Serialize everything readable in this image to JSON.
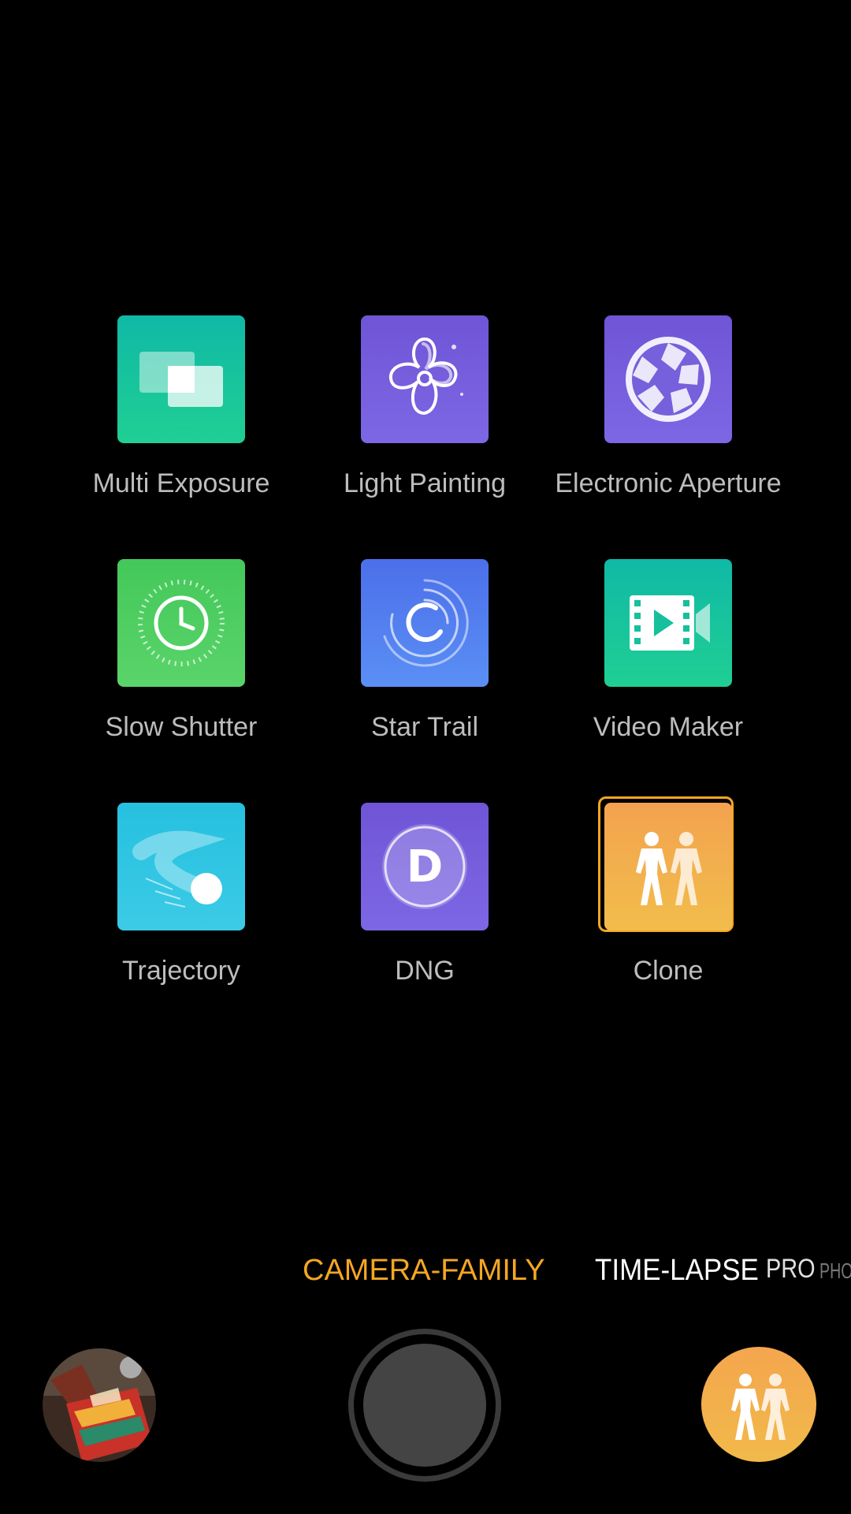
{
  "modes": [
    {
      "label": "Multi Exposure",
      "icon": "multi-exposure-icon",
      "color": "#14b8a0"
    },
    {
      "label": "Light Painting",
      "icon": "light-painting-icon",
      "color": "#7a5fd8"
    },
    {
      "label": "Electronic Aperture",
      "icon": "electronic-aperture-icon",
      "color": "#7a5fd8"
    },
    {
      "label": "Slow Shutter",
      "icon": "slow-shutter-icon",
      "color": "#4cc95a"
    },
    {
      "label": "Star Trail",
      "icon": "star-trail-icon",
      "color": "#4f7fef"
    },
    {
      "label": "Video Maker",
      "icon": "video-maker-icon",
      "color": "#14b8a0"
    },
    {
      "label": "Trajectory",
      "icon": "trajectory-icon",
      "color": "#2ec3e0"
    },
    {
      "label": "DNG",
      "icon": "dng-icon",
      "color": "#7a5fd8",
      "letter": "D"
    },
    {
      "label": "Clone",
      "icon": "clone-icon",
      "color": "#f4a64e",
      "selected": true
    }
  ],
  "mode_bar": {
    "tabs": [
      "CAMERA-FAMILY",
      "TIME-LAPSE",
      "PRO",
      "PHOTO"
    ],
    "active": "CAMERA-FAMILY",
    "active_color": "#f5a623"
  },
  "controls": {
    "gallery_icon": "gallery-thumbnail",
    "shutter_icon": "shutter-button",
    "mode_switch_icon": "clone-mode-icon"
  }
}
